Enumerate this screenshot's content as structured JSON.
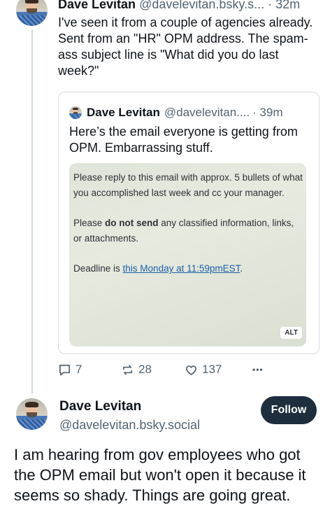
{
  "post1": {
    "author_name": "Dave Levitan",
    "author_handle": "@davelevitan.bsky.s...",
    "time": "· 32m",
    "text": "I've seen it from a couple of agencies already. Sent from an \"HR\" OPM address. The spam-ass subject line is \"What did you do last week?\"",
    "quote": {
      "author_name": "Dave Levitan",
      "author_handle": "@davelevitan....",
      "time": "· 39m",
      "text": "Here’s the email everyone is getting from OPM. Embarrassing stuff.",
      "image": {
        "line1": "Please reply to this email with approx. 5 bullets of what you accomplished last week and cc your manager.",
        "line2_pre": "Please ",
        "line2_bold": "do not send",
        "line2_post": " any classified information, links, or attachments.",
        "line3_pre": "Deadline is ",
        "line3_link": "this Monday at 11:59pmEST",
        "line3_post": ".",
        "alt_label": "ALT"
      }
    },
    "actions": {
      "replies": "7",
      "reposts": "28",
      "likes": "137",
      "more": "•••"
    },
    "icons": [
      "reply-icon",
      "repost-icon",
      "like-icon",
      "more-icon"
    ]
  },
  "post2": {
    "author_name": "Dave Levitan",
    "author_handle": "@davelevitan.bsky.social",
    "follow_label": "Follow",
    "text": "I am hearing from gov employees who got the OPM email but won't open it because it seems so shady. Things are going great."
  },
  "colors": {
    "secondary_text": "#536471",
    "follow_button": "#1e2e3d",
    "link": "#1b5fa8",
    "border": "#d6dde2"
  }
}
